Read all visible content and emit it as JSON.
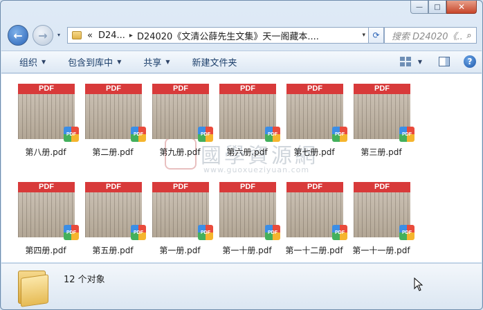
{
  "window": {
    "caption": {
      "minimize": "—",
      "maximize": "□",
      "close": "✕"
    }
  },
  "nav": {
    "back": "←",
    "forward": "→",
    "history_dropdown": "▾"
  },
  "address": {
    "overflow": "«",
    "crumbs": [
      "D24...",
      "D24020《文清公薛先生文集》天一阁藏本...."
    ],
    "separator": "▸",
    "dropdown": "▾",
    "refresh": "⟳"
  },
  "search": {
    "placeholder": "搜索 D24020《...",
    "icon": "search-icon"
  },
  "toolbar": {
    "organize": "组织",
    "include_library": "包含到库中",
    "share": "共享",
    "new_folder": "新建文件夹",
    "help": "?"
  },
  "files": [
    {
      "name": "第八册.pdf"
    },
    {
      "name": "第二册.pdf"
    },
    {
      "name": "第九册.pdf"
    },
    {
      "name": "第六册.pdf"
    },
    {
      "name": "第七册.pdf"
    },
    {
      "name": "第三册.pdf"
    },
    {
      "name": "第四册.pdf"
    },
    {
      "name": "第五册.pdf"
    },
    {
      "name": "第一册.pdf"
    },
    {
      "name": "第一十册.pdf"
    },
    {
      "name": "第一十二册.pdf"
    },
    {
      "name": "第一十一册.pdf"
    }
  ],
  "thumb_header": "PDF",
  "badge_text": "PDF",
  "watermark": {
    "text": "國學資源網",
    "url": "www.guoxueziyuan.com"
  },
  "status": {
    "count": "12 个对象"
  },
  "colors": {
    "pdf_header": "#d83a3a",
    "accent": "#2a63b7"
  }
}
